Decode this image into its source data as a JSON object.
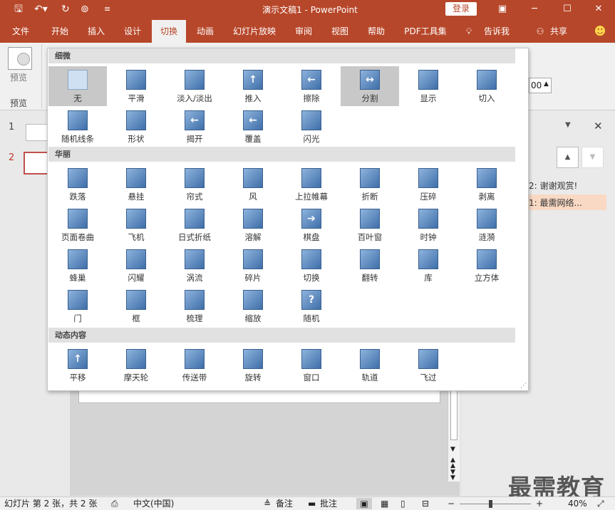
{
  "titlebar": {
    "title": "演示文稿1 - PowerPoint",
    "login": "登录",
    "save_icon": "save-icon",
    "undo_icon": "undo-icon",
    "redo_icon": "redo-icon"
  },
  "tabs": [
    "文件",
    "开始",
    "插入",
    "设计",
    "切换",
    "动画",
    "幻灯片放映",
    "审阅",
    "视图",
    "帮助",
    "PDF工具集",
    "告诉我",
    "共享"
  ],
  "ribbon": {
    "preview_btn": "预览",
    "preview_group": "预览",
    "duration": "00"
  },
  "slides": {
    "num1": "1",
    "num2": "2"
  },
  "pane": {
    "item2": "2: 谢谢观赏!",
    "item1": "1: 最需网络..."
  },
  "gallery": {
    "sections": [
      {
        "title": "细微",
        "items": [
          "无",
          "平滑",
          "淡入/淡出",
          "推入",
          "擦除",
          "分割",
          "显示",
          "切入",
          "随机线条",
          "形状",
          "揭开",
          "覆盖",
          "闪光"
        ]
      },
      {
        "title": "华丽",
        "items": [
          "跌落",
          "悬挂",
          "帘式",
          "风",
          "上拉帷幕",
          "折断",
          "压碎",
          "剥离",
          "页面卷曲",
          "飞机",
          "日式折纸",
          "溶解",
          "棋盘",
          "百叶窗",
          "时钟",
          "涟漪",
          "蜂巢",
          "闪耀",
          "涡流",
          "碎片",
          "切换",
          "翻转",
          "库",
          "立方体",
          "门",
          "框",
          "梳理",
          "缩放",
          "随机"
        ]
      },
      {
        "title": "动态内容",
        "items": [
          "平移",
          "摩天轮",
          "传送带",
          "旋转",
          "窗口",
          "轨道",
          "飞过"
        ]
      }
    ]
  },
  "status": {
    "slide_info": "幻灯片 第 2 张，共 2 张",
    "lang": "中文(中国)",
    "notes": "备注",
    "comments": "批注",
    "zoom": "40%"
  },
  "watermark": "最需教育"
}
